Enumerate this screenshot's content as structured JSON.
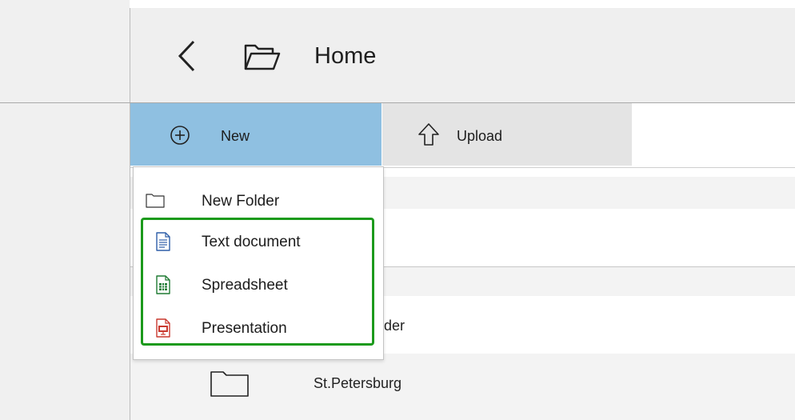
{
  "header": {
    "title": "Home",
    "back_icon": "chevron-left-icon",
    "folder_icon": "folder-open-icon"
  },
  "toolbar": {
    "new_label": "New",
    "new_icon": "plus-circle-icon",
    "upload_label": "Upload",
    "upload_icon": "arrow-up-icon",
    "new_active_color": "#8fc0e1"
  },
  "new_menu": {
    "items": [
      {
        "label": "New Folder",
        "icon": "folder-icon",
        "color": "#333333"
      },
      {
        "label": "Text document",
        "icon": "text-document-icon",
        "color": "#2e5ea8"
      },
      {
        "label": "Spreadsheet",
        "icon": "spreadsheet-icon",
        "color": "#1e7a32"
      },
      {
        "label": "Presentation",
        "icon": "presentation-icon",
        "color": "#c9392f"
      }
    ],
    "highlight_color": "#1c9a1c"
  },
  "file_list": {
    "rows": [
      {
        "label": "der"
      },
      {
        "label": "St.Petersburg",
        "icon": "folder-icon"
      }
    ]
  }
}
